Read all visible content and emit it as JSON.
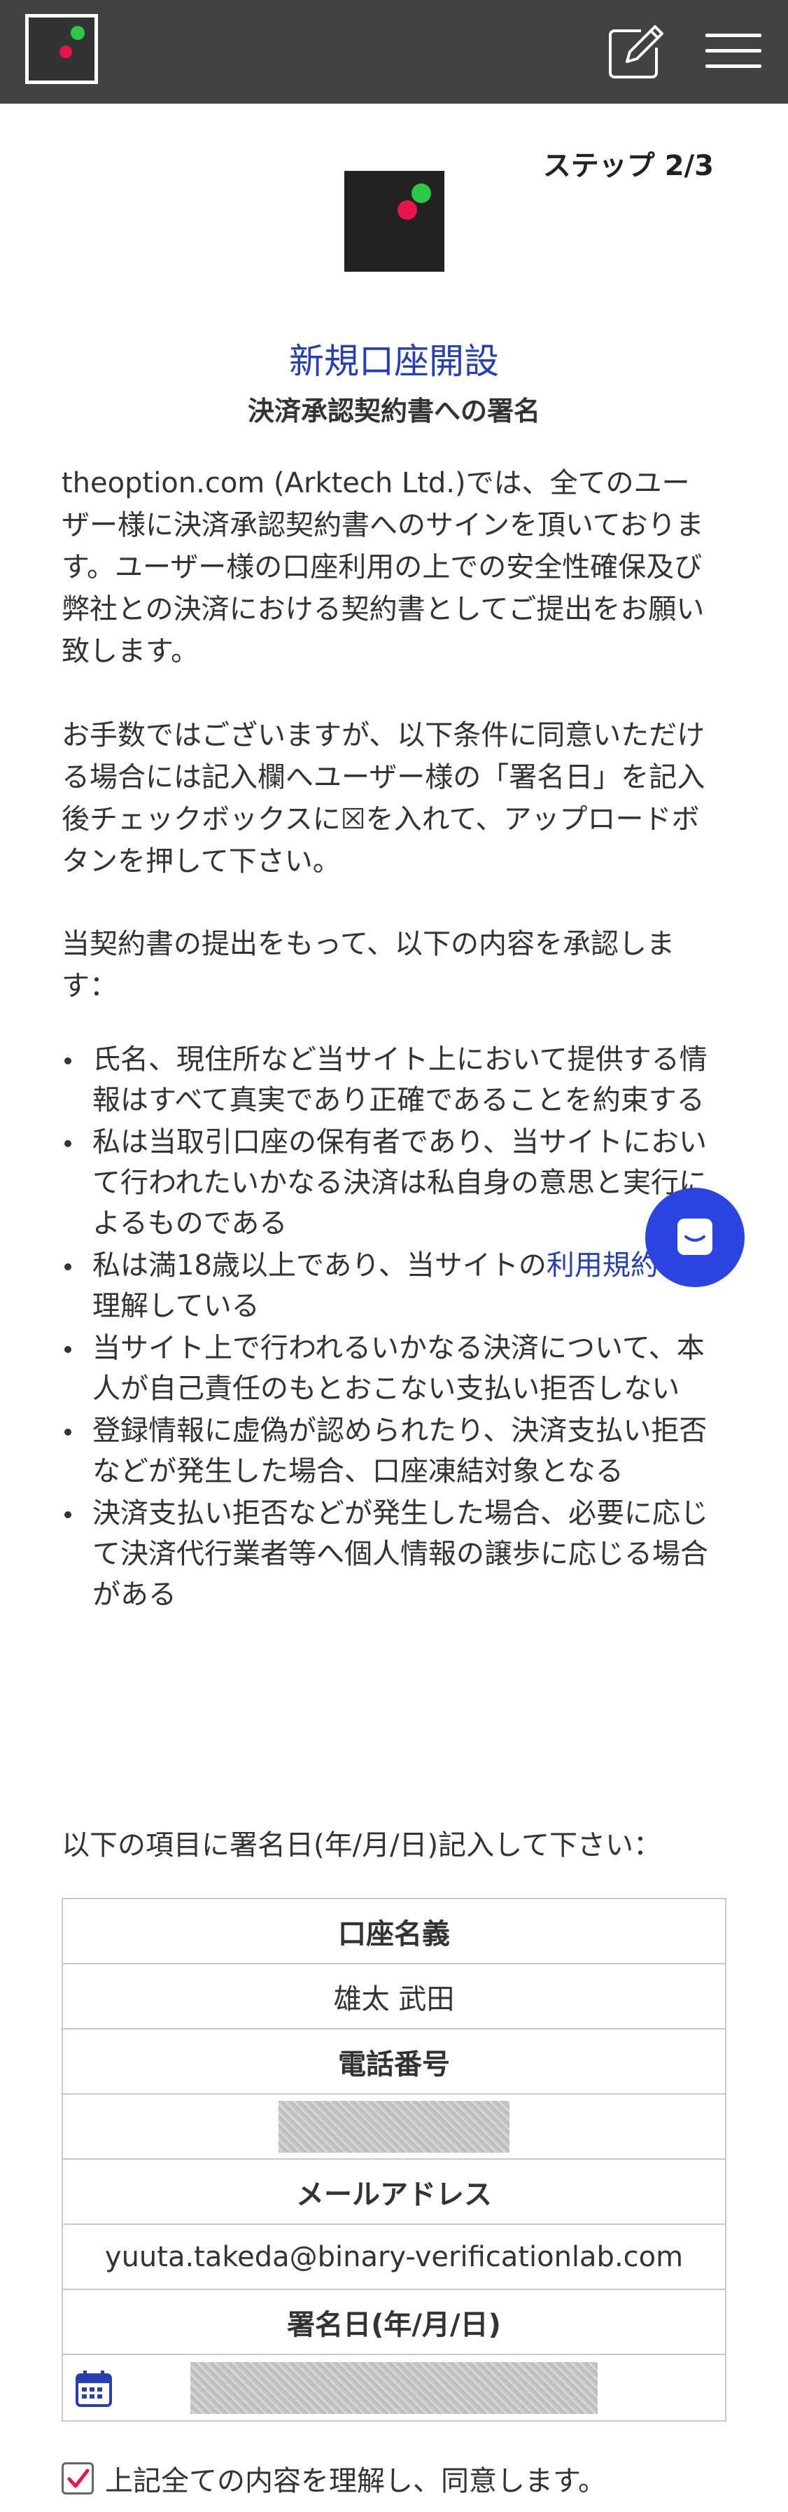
{
  "header": {
    "edit_icon": "pencil-square-icon",
    "menu_icon": "hamburger-icon"
  },
  "step": {
    "label": "ステップ 2/3"
  },
  "page": {
    "title": "新規口座開設",
    "subtitle": "決済承認契約書への署名",
    "paragraph1": "theoption.com (Arktech Ltd.)では、全てのユーザー様に決済承認契約書へのサインを頂いております。ユーザー様の口座利用の上での安全性確保及び弊社との決済における契約書としてご提出をお願い致します。",
    "paragraph2": "お手数ではございますが、以下条件に同意いただける場合には記入欄へユーザー様の「署名日」を記入後チェックボックスに☒を入れて、アップロードボタンを押して下さい。",
    "paragraph3": "当契約書の提出をもって、以下の内容を承認します："
  },
  "bullets": [
    {
      "text": "氏名、現住所など当サイト上において提供する情報はすべて真実であり正確であることを約束する"
    },
    {
      "text": "私は当取引口座の保有者であり、当サイトにおいて行われたいかなる決済は私自身の意思と実行によるものである"
    },
    {
      "text_before": "私は満18歳以上であり、当サイトの",
      "link": "利用規約",
      "text_after": "を理解している"
    },
    {
      "text": "当サイト上で行われるいかなる決済について、本人が自己責任のもとおこない支払い拒否しない"
    },
    {
      "text": "登録情報に虚偽が認められたり、決済支払い拒否などが発生した場合、口座凍結対象となる"
    },
    {
      "text": "決済支払い拒否などが発生した場合、必要に応じて決済代行業者等へ個人情報の譲歩に応じる場合がある"
    }
  ],
  "form": {
    "instruction": "以下の項目に署名日(年/月/日)記入して下さい：",
    "account_name_label": "口座名義",
    "account_name_value": "雄太 武田",
    "phone_label": "電話番号",
    "email_label": "メールアドレス",
    "email_value": "yuuta.takeda@binary-verificationlab.com",
    "date_label": "署名日(年/月/日)",
    "date_icon": "calendar-icon"
  },
  "agree": {
    "label": "上記全ての内容を理解し、同意します。",
    "checked": true
  },
  "colors": {
    "header_bg": "#424242",
    "accent": "#2640b3",
    "chat": "#2b45e0",
    "check": "#e8154a"
  }
}
